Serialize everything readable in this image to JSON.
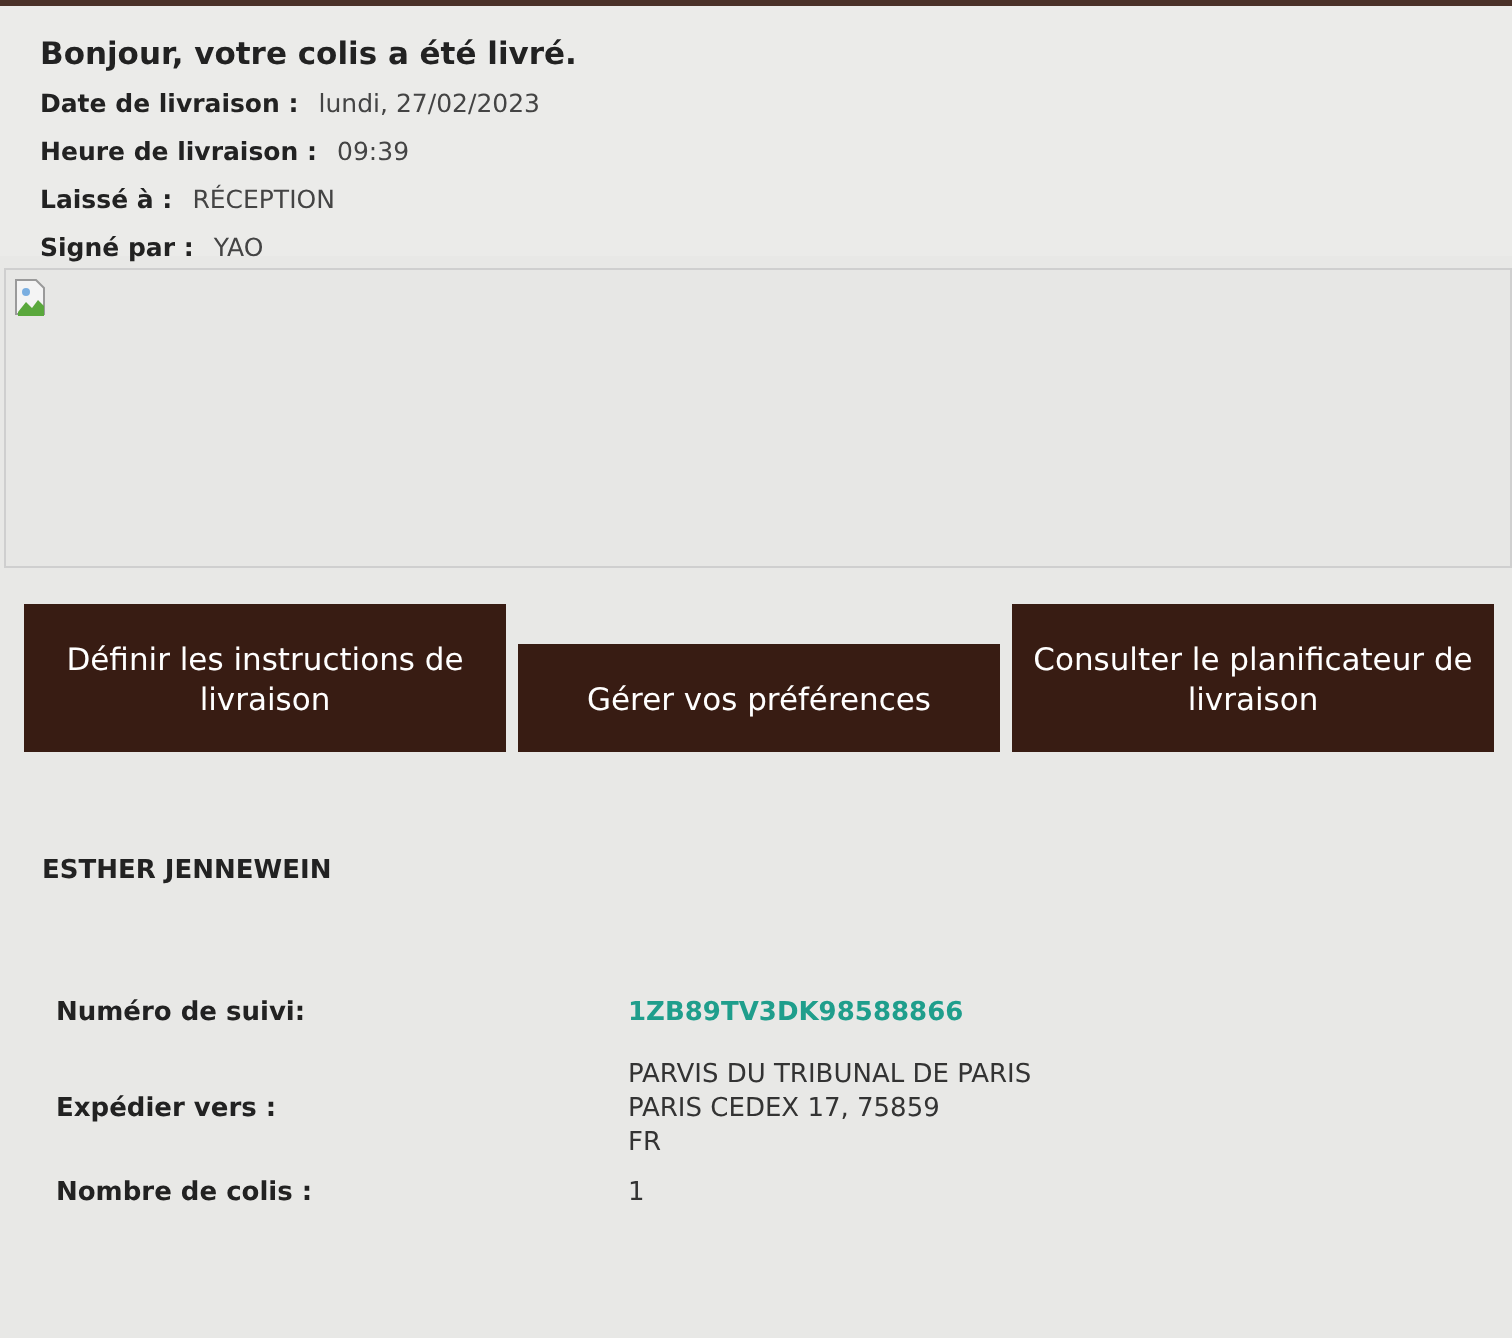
{
  "header": {
    "title": "Bonjour, votre colis a été livré.",
    "fields": [
      {
        "label": "Date de livraison :",
        "value": "lundi, 27/02/2023"
      },
      {
        "label": "Heure de livraison :",
        "value": "09:39"
      },
      {
        "label": "Laissé à :",
        "value": "RÉCEPTION"
      },
      {
        "label": "Signé par :",
        "value": "YAO"
      }
    ]
  },
  "image": {
    "kind": "broken-image"
  },
  "buttons": [
    "Définir les instructions de livraison",
    "Gérer vos préférences",
    "Consulter le planificateur de livraison"
  ],
  "recipient": "ESTHER JENNEWEIN",
  "details": [
    {
      "label": "Numéro de suivi:",
      "kind": "link",
      "lines": [
        "1ZB89TV3DK98588866"
      ]
    },
    {
      "label": "Expédier vers :",
      "kind": "text",
      "lines": [
        "PARVIS DU TRIBUNAL DE PARIS",
        "PARIS CEDEX 17, 75859",
        "FR"
      ]
    },
    {
      "label": "Nombre de colis :",
      "kind": "text",
      "lines": [
        "1"
      ]
    }
  ]
}
